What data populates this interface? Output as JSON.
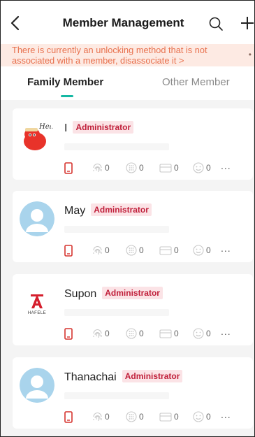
{
  "header": {
    "title": "Member Management"
  },
  "notice": {
    "text": "There is currently an unlocking method that is not associated with a member, disassociate it >"
  },
  "tabs": [
    {
      "label": "Family Member",
      "active": true
    },
    {
      "label": "Other Member",
      "active": false
    }
  ],
  "members": [
    {
      "name": "I",
      "role": "Administrator",
      "avatar": "cartoon-hello-icon",
      "counts": {
        "fingerprint": "0",
        "password": "0",
        "card": "0",
        "face": "0"
      },
      "more": "..."
    },
    {
      "name": "May",
      "role": "Administrator",
      "avatar": "default-avatar-icon",
      "counts": {
        "fingerprint": "0",
        "password": "0",
        "card": "0",
        "face": "0"
      },
      "more": "..."
    },
    {
      "name": "Supon",
      "role": "Administrator",
      "avatar": "hafele-logo",
      "logo_text": "HAFELE",
      "counts": {
        "fingerprint": "0",
        "password": "0",
        "card": "0",
        "face": "0"
      },
      "more": "..."
    },
    {
      "name": "Thanachai",
      "role": "Administrator",
      "avatar": "default-avatar-icon",
      "counts": {
        "fingerprint": "0",
        "password": "0",
        "card": "0",
        "face": "0"
      },
      "more": "..."
    }
  ],
  "colors": {
    "accent": "#15b8a3",
    "badge_bg": "#fbe3e6",
    "badge_text": "#c01f3a",
    "notice_bg": "#fdeae3",
    "notice_text": "#e8714e"
  }
}
